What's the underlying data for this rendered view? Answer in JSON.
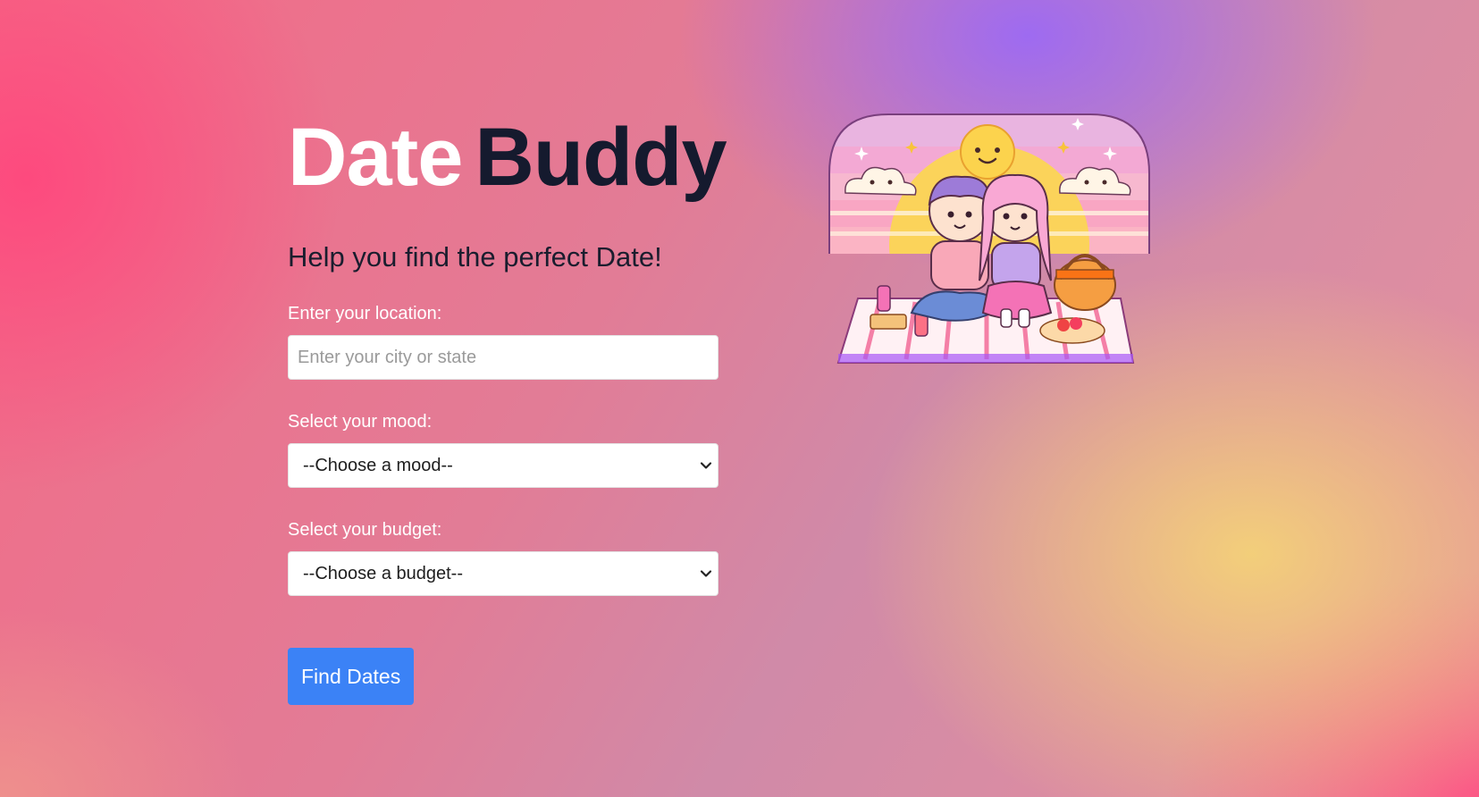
{
  "brand": {
    "word1": "Date",
    "word2": "Buddy"
  },
  "tagline": "Help you find the perfect Date!",
  "form": {
    "location_label": "Enter your location:",
    "location_placeholder": "Enter your city or state",
    "location_value": "",
    "mood_label": "Select your mood:",
    "mood_selected": "--Choose a mood--",
    "budget_label": "Select your budget:",
    "budget_selected": "--Choose a budget--",
    "submit_label": "Find Dates"
  },
  "illustration": {
    "subject": "picnic couple illustration",
    "icon": "couple-picnic-illustration"
  },
  "colors": {
    "brand_dark": "#151a2e",
    "button": "#3b82f6",
    "text_light": "#ffffff"
  }
}
